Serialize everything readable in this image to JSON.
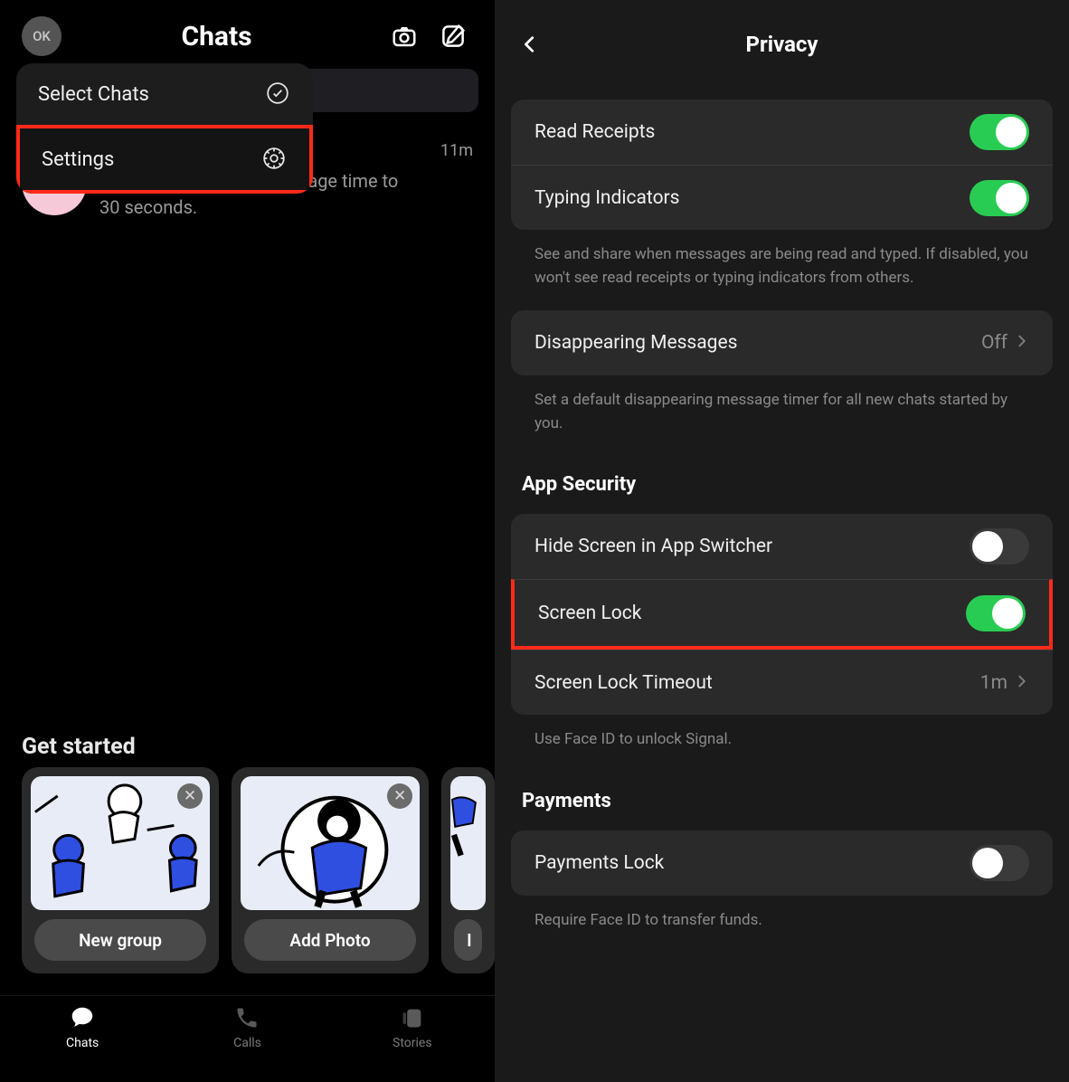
{
  "left": {
    "avatar_initials": "OK",
    "header_title": "Chats",
    "context_menu": {
      "select_chats": "Select Chats",
      "settings": "Settings"
    },
    "chat": {
      "snippet_tail": "sage time to",
      "snippet_line2": "30 seconds.",
      "time": "11m"
    },
    "get_started": {
      "title": "Get started",
      "cards": [
        {
          "button": "New group"
        },
        {
          "button": "Add Photo"
        },
        {
          "button": "I"
        }
      ]
    },
    "tabs": {
      "chats": "Chats",
      "calls": "Calls",
      "stories": "Stories"
    }
  },
  "right": {
    "title": "Privacy",
    "read_receipts": "Read Receipts",
    "typing_indicators": "Typing Indicators",
    "receipts_footer": "See and share when messages are being read and typed. If disabled, you won't see read receipts or typing indicators from others.",
    "disappearing": "Disappearing Messages",
    "disappearing_value": "Off",
    "disappearing_footer": "Set a default disappearing message timer for all new chats started by you.",
    "app_security_title": "App Security",
    "hide_screen": "Hide Screen in App Switcher",
    "screen_lock": "Screen Lock",
    "screen_lock_timeout": "Screen Lock Timeout",
    "screen_lock_timeout_value": "1m",
    "faceid_footer": "Use Face ID to unlock Signal.",
    "payments_title": "Payments",
    "payments_lock": "Payments Lock",
    "payments_footer": "Require Face ID to transfer funds.",
    "toggles": {
      "read_receipts": true,
      "typing_indicators": true,
      "hide_screen": false,
      "screen_lock": true,
      "payments_lock": false
    }
  }
}
